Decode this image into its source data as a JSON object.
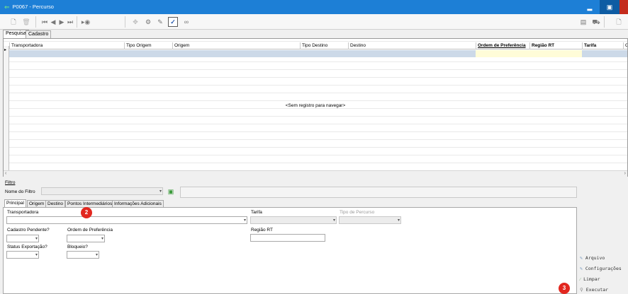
{
  "window": {
    "title": "P0067 - Percurso",
    "min": "▂",
    "max": "▣",
    "close": "✕"
  },
  "toolbar": {
    "icons": [
      "new-doc-icon",
      "delete-icon",
      "first-icon",
      "prev-icon",
      "next-icon",
      "last-icon",
      "scan-icon",
      "move-icon",
      "gear-icon",
      "attach-icon",
      "check-icon",
      "link-icon",
      "print-icon",
      "truck-icon"
    ]
  },
  "page_tabs": [
    "Pesquisa",
    "Cadastro"
  ],
  "grid": {
    "columns": [
      "Transportadora",
      "Tipo Origem",
      "Origem",
      "Tipo Destino",
      "Destino",
      "Ordem de Preferência",
      "Região RT",
      "Tarifa",
      "G"
    ],
    "empty_message": "<Sem registro para navegar>"
  },
  "filter": {
    "section_label": "Filtro",
    "name_label": "Nome do Filtro",
    "tabs": [
      "Principal",
      "Origem",
      "Destino",
      "Pontos Intermediários",
      "Informações Adicionais"
    ],
    "fields": {
      "transportadora": "Transportadora",
      "tarifa": "Tarifa",
      "tipo_percurso": "Tipo de Percurso",
      "cadastro_pendente": "Cadastro Pendente?",
      "ordem_preferencia": "Ordem de Preferência",
      "regiao_rt": "Região RT",
      "status_exportacao": "Status Exportação?",
      "bloqueio": "Bloqueio?"
    }
  },
  "actions": [
    "Arquivo",
    "Configurações",
    "Limpar",
    "Executar"
  ],
  "badges": {
    "b2": "2",
    "b3": "3"
  },
  "colors": {
    "titlebar": "#1d7fd6",
    "badge": "#e2271f",
    "selected_row": "#ccd9e8"
  }
}
